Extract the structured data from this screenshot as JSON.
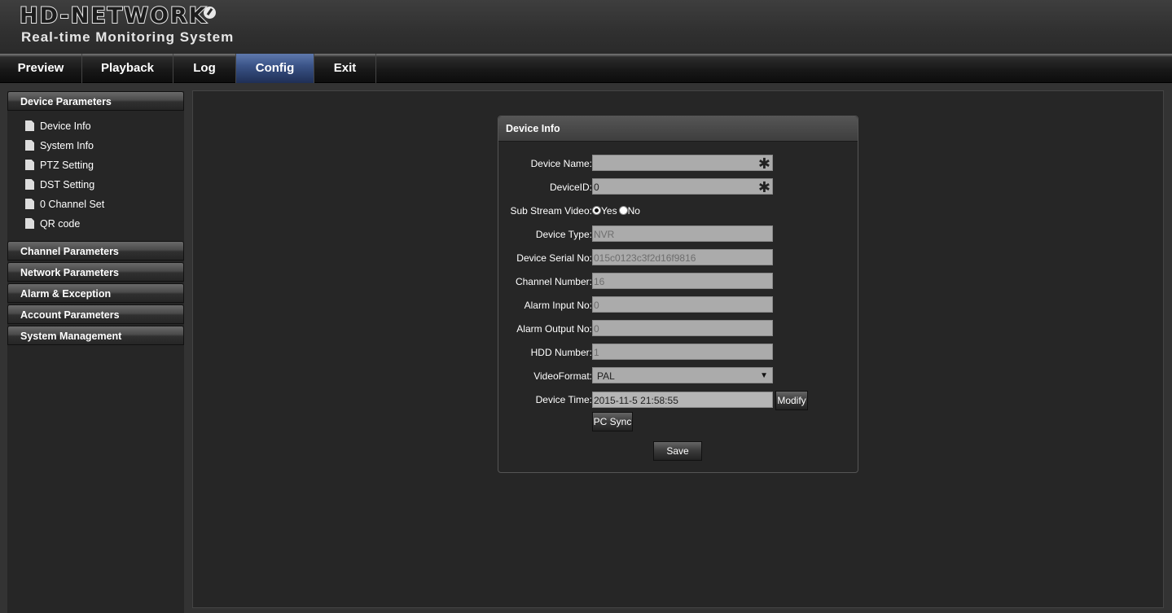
{
  "header": {
    "logo": "HD-NETWORK",
    "subtitle": "Real-time Monitoring System"
  },
  "nav": [
    {
      "label": "Preview"
    },
    {
      "label": "Playback"
    },
    {
      "label": "Log"
    },
    {
      "label": "Config",
      "active": true
    },
    {
      "label": "Exit"
    }
  ],
  "sidebar": {
    "groups": [
      {
        "label": "Device Parameters"
      },
      {
        "label": "Channel Parameters"
      },
      {
        "label": "Network Parameters"
      },
      {
        "label": "Alarm & Exception"
      },
      {
        "label": "Account Parameters"
      },
      {
        "label": "System Management"
      }
    ],
    "device_items": [
      {
        "label": "Device Info"
      },
      {
        "label": "System Info"
      },
      {
        "label": "PTZ Setting"
      },
      {
        "label": "DST Setting"
      },
      {
        "label": "0 Channel Set"
      },
      {
        "label": "QR code"
      }
    ]
  },
  "panel": {
    "title": "Device Info",
    "fields": {
      "device_name": {
        "label": "Device Name:",
        "value": ""
      },
      "device_id": {
        "label": "DeviceID:",
        "value": "0"
      },
      "sub_stream": {
        "label": "Sub Stream Video:",
        "yes": "Yes",
        "no": "No",
        "selected": "Yes"
      },
      "device_type": {
        "label": "Device Type:",
        "value": "NVR"
      },
      "serial_no": {
        "label": "Device Serial No:",
        "value": "015c0123c3f2d16f9816"
      },
      "channel_number": {
        "label": "Channel Number:",
        "value": "16"
      },
      "alarm_input": {
        "label": "Alarm Input No:",
        "value": "0"
      },
      "alarm_output": {
        "label": "Alarm Output No:",
        "value": "0"
      },
      "hdd_number": {
        "label": "HDD Number:",
        "value": "1"
      },
      "video_format": {
        "label": "VideoFormat:",
        "value": "PAL"
      },
      "device_time": {
        "label": "Device Time:",
        "value": "2015-11-5 21:58:55"
      }
    },
    "required_mark": "✱",
    "select_arrow": "▼",
    "modify_label": "Modify",
    "pc_sync_label": "PC Sync",
    "save_label": "Save"
  }
}
